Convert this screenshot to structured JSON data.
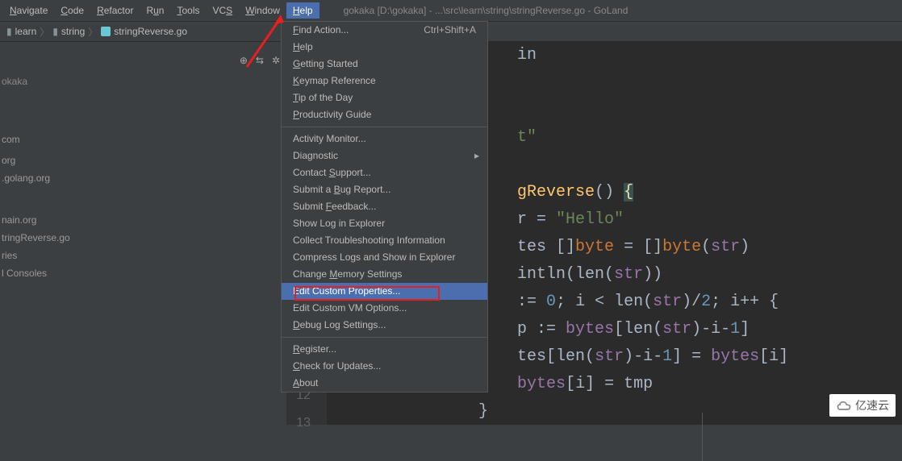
{
  "menubar": {
    "items": [
      {
        "label": "Navigate",
        "u": "N"
      },
      {
        "label": "Code",
        "u": "C"
      },
      {
        "label": "Refactor",
        "u": "R"
      },
      {
        "label": "Run",
        "u": "u"
      },
      {
        "label": "Tools",
        "u": "T"
      },
      {
        "label": "VCS",
        "u": "S"
      },
      {
        "label": "Window",
        "u": "W"
      },
      {
        "label": "Help",
        "u": "H",
        "active": true
      }
    ],
    "title": "gokaka [D:\\gokaka] - ...\\src\\learn\\string\\stringReverse.go - GoLand"
  },
  "breadcrumb": {
    "parts": [
      "learn",
      "string",
      "stringReverse.go"
    ]
  },
  "sidebar": {
    "title": "okaka",
    "items": [
      "com",
      "org",
      ".golang.org",
      "",
      "nain.org",
      "tringReverse.go",
      "ries",
      "l Consoles"
    ]
  },
  "help_menu": {
    "groups": [
      [
        {
          "label": "Find Action...",
          "u": "F",
          "shortcut": "Ctrl+Shift+A"
        },
        {
          "label": "Help",
          "u": "H"
        },
        {
          "label": "Getting Started",
          "u": "G"
        },
        {
          "label": "Keymap Reference",
          "u": "K"
        },
        {
          "label": "Tip of the Day",
          "u": "T"
        },
        {
          "label": "Productivity Guide",
          "u": "P"
        }
      ],
      [
        {
          "label": "Activity Monitor..."
        },
        {
          "label": "Diagnostic",
          "submenu": true
        },
        {
          "label": "Contact Support...",
          "u": "S"
        },
        {
          "label": "Submit a Bug Report...",
          "u": "B"
        },
        {
          "label": "Submit Feedback...",
          "u": "F"
        },
        {
          "label": "Show Log in Explorer"
        },
        {
          "label": "Collect Troubleshooting Information"
        },
        {
          "label": "Compress Logs and Show in Explorer"
        },
        {
          "label": "Change Memory Settings",
          "u": "M"
        },
        {
          "label": "Edit Custom Properties...",
          "hovered": true
        },
        {
          "label": "Edit Custom VM Options..."
        },
        {
          "label": "Debug Log Settings...",
          "u": "D"
        }
      ],
      [
        {
          "label": "Register...",
          "u": "R"
        },
        {
          "label": "Check for Updates...",
          "u": "C"
        },
        {
          "label": "About",
          "u": "A"
        }
      ]
    ]
  },
  "editor": {
    "visible_lines": [
      "12",
      "13"
    ]
  },
  "watermark": "亿速云"
}
